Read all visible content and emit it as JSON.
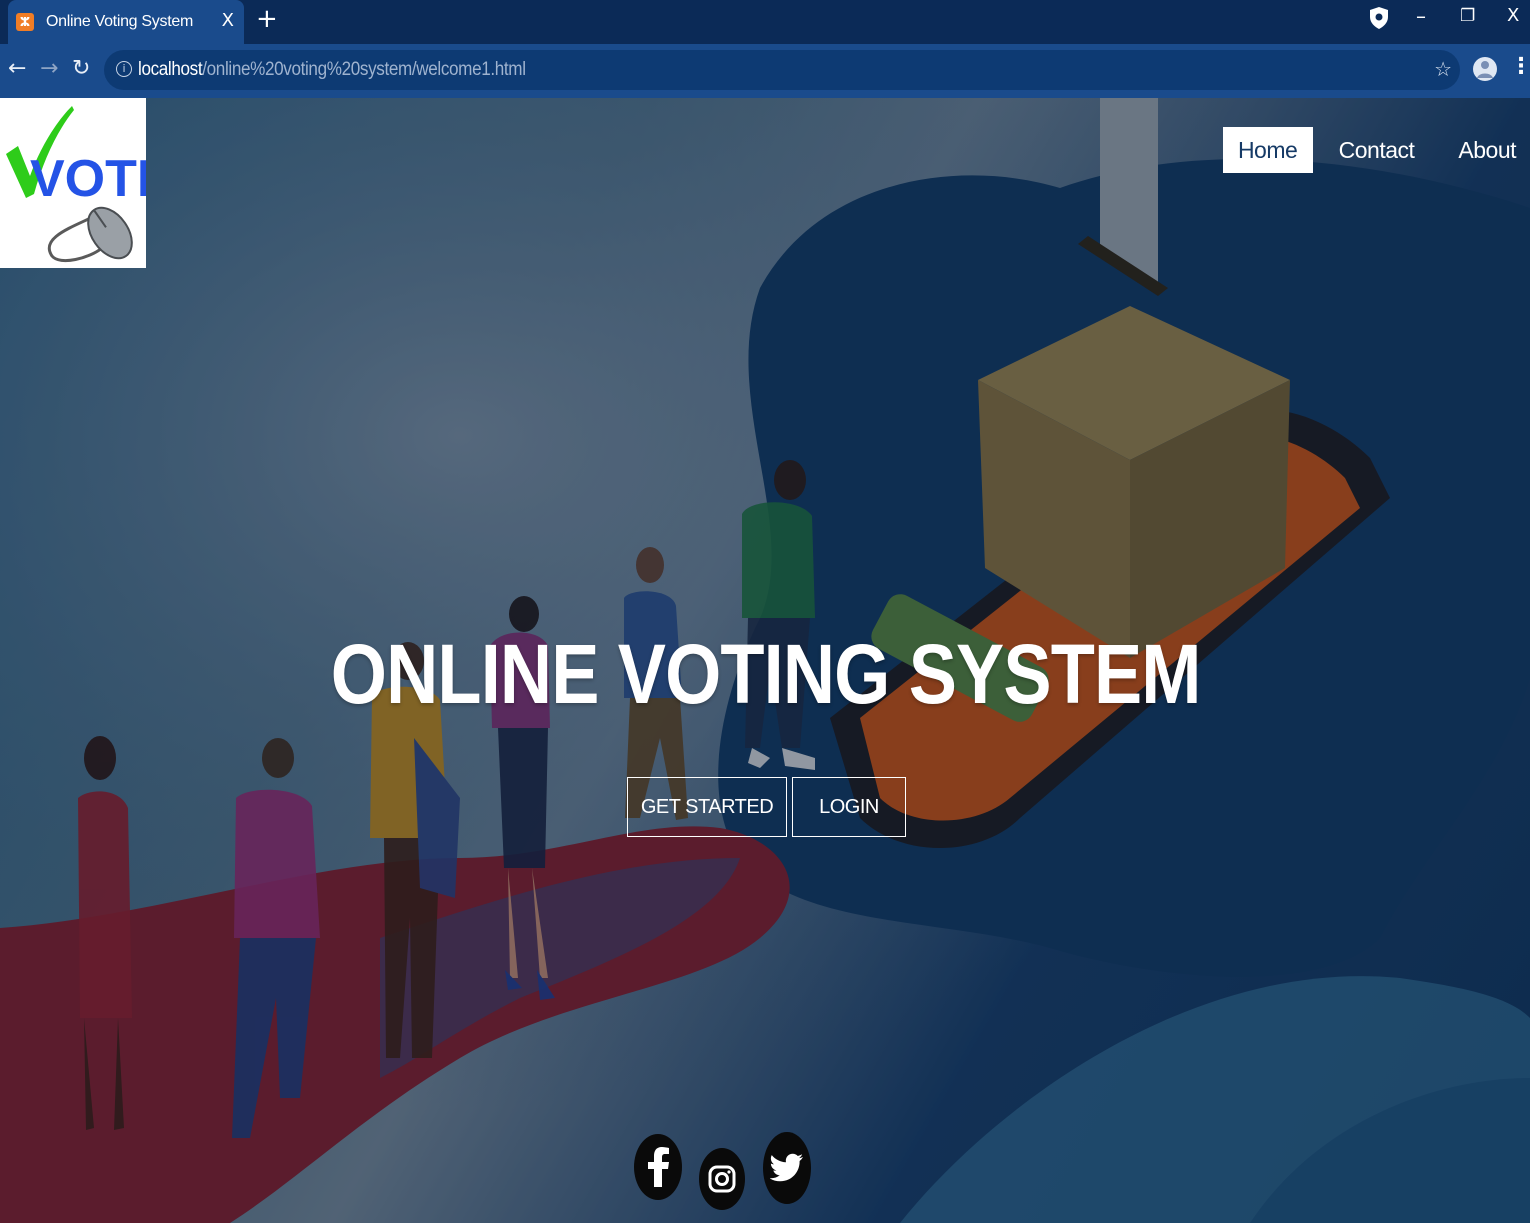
{
  "browser": {
    "tab_title": "Online Voting System",
    "tab_close": "X",
    "new_tab": "+",
    "url_host": "localhost",
    "url_path": "/online%20voting%20system/welcome1.html",
    "window_controls": {
      "minimize": "–",
      "restore": "❐",
      "close": "X"
    }
  },
  "site": {
    "logo_text": "VOTE",
    "nav": [
      {
        "label": "Home",
        "active": true
      },
      {
        "label": "Contact",
        "active": false
      },
      {
        "label": "About",
        "active": false
      }
    ],
    "hero_title": "ONLINE VOTING SYSTEM",
    "buttons": {
      "get_started": "GET STARTED",
      "login": "LOGIN"
    },
    "social": [
      "facebook-icon",
      "instagram-icon",
      "twitter-icon"
    ]
  },
  "colors": {
    "tab_strip": "#0b2a57",
    "toolbar": "#1a4b8c",
    "nav_active_bg": "#ffffff",
    "logo_check": "#2ecc1a",
    "logo_text": "#2453e6"
  }
}
